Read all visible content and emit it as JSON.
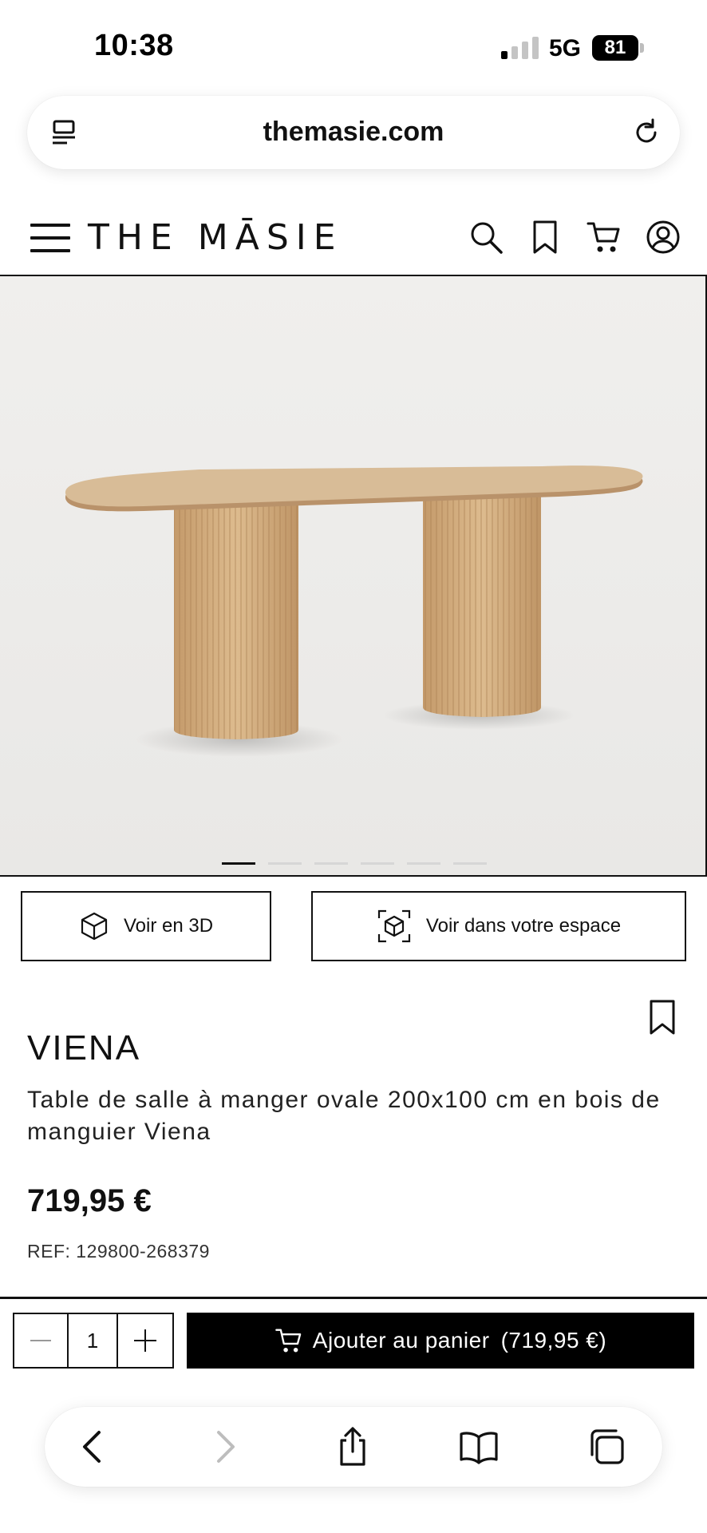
{
  "status_bar": {
    "time": "10:38",
    "network": "5G",
    "battery": "81"
  },
  "browser": {
    "url": "themasie.com"
  },
  "site": {
    "brand": "THE MĀSIE"
  },
  "carousel": {
    "count": 6,
    "active_index": 0
  },
  "actions": {
    "view_3d": "Voir en 3D",
    "view_ar": "Voir dans votre espace"
  },
  "product": {
    "name": "VIENA",
    "description": "Table de salle à manger ovale 200x100 cm en bois de manguier Viena",
    "price": "719,95 €",
    "ref": "REF: 129800-268379"
  },
  "cart": {
    "quantity": "1",
    "add_label": "Ajouter au panier",
    "price_suffix": "(719,95 €)"
  },
  "colors": {
    "accent": "#000000",
    "image_bg": "#edecea",
    "wood": "#d2b086"
  }
}
